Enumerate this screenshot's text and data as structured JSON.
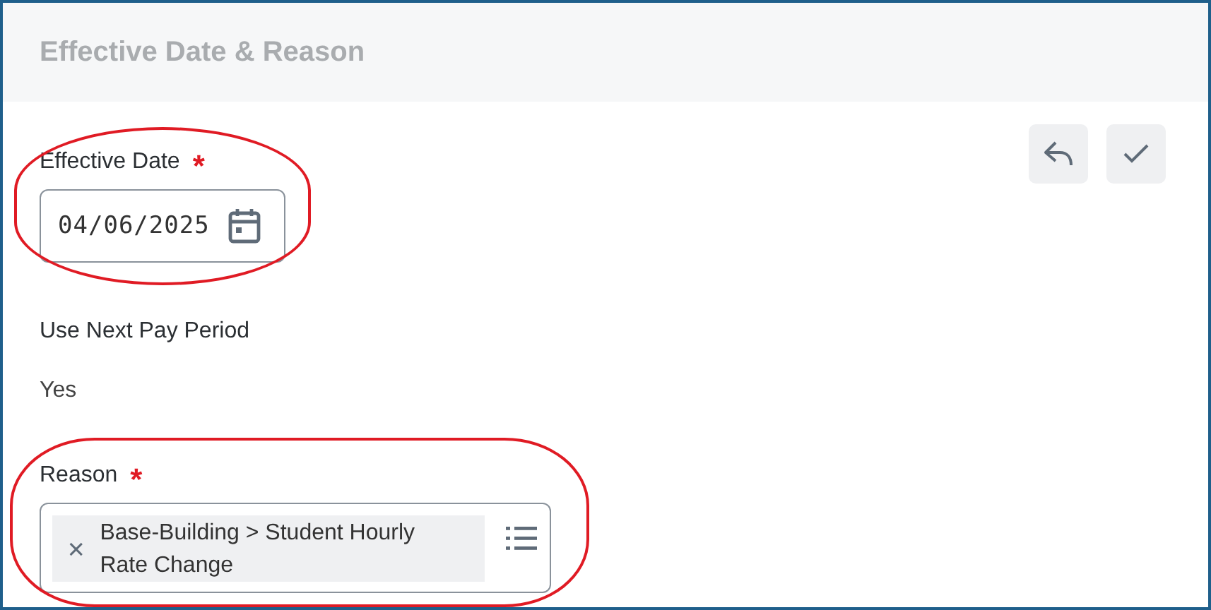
{
  "header": {
    "title": "Effective Date & Reason"
  },
  "actions": [
    {
      "kind": "cancel"
    },
    {
      "kind": "submit"
    }
  ],
  "effective_date": {
    "label": "Effective Date",
    "required_marker": "*",
    "value": "04/06/2025",
    "highlighted": true
  },
  "next_pay_period": {
    "label": "Use Next Pay Period",
    "value": "Yes"
  },
  "reason": {
    "label": "Reason",
    "required_marker": "*",
    "selection": "Base-Building > Student Hourly Rate Change",
    "highlighted": true
  }
}
